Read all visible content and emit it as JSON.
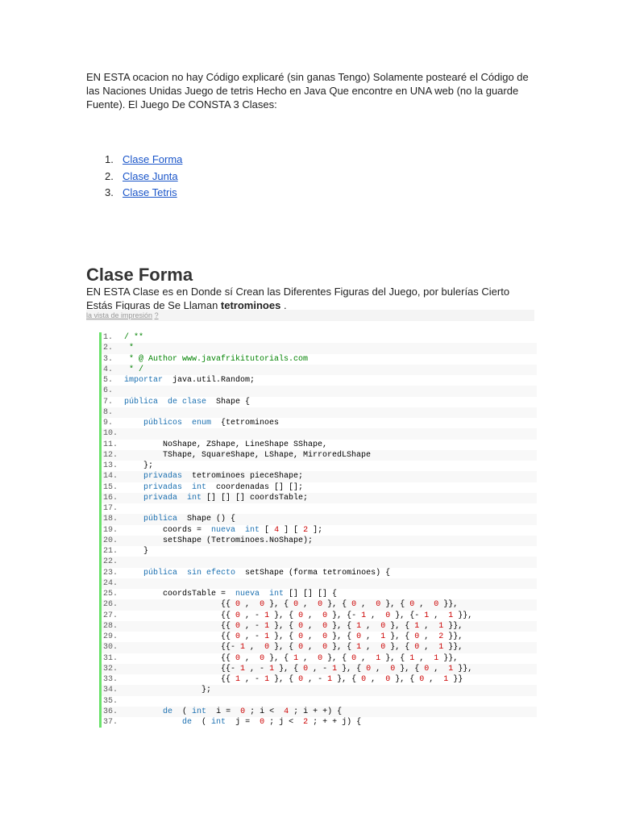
{
  "intro": "EN ESTA ocacion no hay Código explicaré (sin ganas Tengo) Solamente postearé el Código de las Naciones Unidas Juego de tetris Hecho en Java Que encontre en UNA web (no la guarde Fuente). El Juego De CONSTA 3 Clases:",
  "toc": [
    {
      "num": "1.",
      "label": "Clase Forma"
    },
    {
      "num": "2.",
      "label": "Clase Junta"
    },
    {
      "num": "3.",
      "label": "Clase Tetris"
    }
  ],
  "section": {
    "title": "Clase Forma",
    "para_before": "EN ESTA Clase es en Donde sí Crean las Diferentes Figuras del Juego, por bulerías Cierto Estás Figuras de Se Llaman ",
    "para_bold": "tetrominoes",
    "para_after": " .",
    "print_view": "la vista de impresión",
    "help": "?"
  },
  "code": [
    [
      [
        "c",
        "/ **"
      ]
    ],
    [
      [
        "c",
        " *"
      ]
    ],
    [
      [
        "c",
        " * @ Author www.javafrikitutorials.com"
      ]
    ],
    [
      [
        "c",
        " * /"
      ]
    ],
    [
      [
        "k",
        "importar"
      ],
      [
        "p",
        "  java.util.Random;"
      ]
    ],
    [],
    [
      [
        "k",
        "pública  de clase"
      ],
      [
        "p",
        "  Shape {"
      ]
    ],
    [],
    [
      [
        "p",
        "    "
      ],
      [
        "k",
        "públicos  enum"
      ],
      [
        "p",
        "  {tetrominoes"
      ]
    ],
    [],
    [
      [
        "p",
        "        NoShape, ZShape, LineShape SShape,"
      ]
    ],
    [
      [
        "p",
        "        TShape, SquareShape, LShape, MirroredLShape"
      ]
    ],
    [
      [
        "p",
        "    };"
      ]
    ],
    [
      [
        "p",
        "    "
      ],
      [
        "k",
        "privadas"
      ],
      [
        "p",
        "  tetrominoes pieceShape;"
      ]
    ],
    [
      [
        "p",
        "    "
      ],
      [
        "k",
        "privadas  int"
      ],
      [
        "p",
        "  coordenadas [] [];"
      ]
    ],
    [
      [
        "p",
        "    "
      ],
      [
        "k",
        "privada  int"
      ],
      [
        "p",
        " [] [] [] coordsTable;"
      ]
    ],
    [],
    [
      [
        "p",
        "    "
      ],
      [
        "k",
        "pública"
      ],
      [
        "p",
        "  Shape () {"
      ]
    ],
    [
      [
        "p",
        "        coords =  "
      ],
      [
        "k",
        "nueva  int"
      ],
      [
        "p",
        " [ "
      ],
      [
        "n",
        "4"
      ],
      [
        "p",
        " ] [ "
      ],
      [
        "n",
        "2"
      ],
      [
        "p",
        " ];"
      ]
    ],
    [
      [
        "p",
        "        setShape (Tetrominoes.NoShape);"
      ]
    ],
    [
      [
        "p",
        "    }"
      ]
    ],
    [],
    [
      [
        "p",
        "    "
      ],
      [
        "k",
        "pública  sin efecto"
      ],
      [
        "p",
        "  setShape (forma tetrominoes) {"
      ]
    ],
    [],
    [
      [
        "p",
        "        coordsTable =  "
      ],
      [
        "k",
        "nueva  int"
      ],
      [
        "p",
        " [] [] [] {"
      ]
    ],
    [
      [
        "p",
        "                    {{ "
      ],
      [
        "n",
        "0"
      ],
      [
        "p",
        " ,  "
      ],
      [
        "n",
        "0"
      ],
      [
        "p",
        " }, { "
      ],
      [
        "n",
        "0"
      ],
      [
        "p",
        " ,  "
      ],
      [
        "n",
        "0"
      ],
      [
        "p",
        " }, { "
      ],
      [
        "n",
        "0"
      ],
      [
        "p",
        " ,  "
      ],
      [
        "n",
        "0"
      ],
      [
        "p",
        " }, { "
      ],
      [
        "n",
        "0"
      ],
      [
        "p",
        " ,  "
      ],
      [
        "n",
        "0"
      ],
      [
        "p",
        " }},"
      ]
    ],
    [
      [
        "p",
        "                    {{ "
      ],
      [
        "n",
        "0"
      ],
      [
        "p",
        " , - "
      ],
      [
        "n",
        "1"
      ],
      [
        "p",
        " }, { "
      ],
      [
        "n",
        "0"
      ],
      [
        "p",
        " ,  "
      ],
      [
        "n",
        "0"
      ],
      [
        "p",
        " }, {- "
      ],
      [
        "n",
        "1"
      ],
      [
        "p",
        " ,  "
      ],
      [
        "n",
        "0"
      ],
      [
        "p",
        " }, {- "
      ],
      [
        "n",
        "1"
      ],
      [
        "p",
        " ,  "
      ],
      [
        "n",
        "1"
      ],
      [
        "p",
        " }},"
      ]
    ],
    [
      [
        "p",
        "                    {{ "
      ],
      [
        "n",
        "0"
      ],
      [
        "p",
        " , - "
      ],
      [
        "n",
        "1"
      ],
      [
        "p",
        " }, { "
      ],
      [
        "n",
        "0"
      ],
      [
        "p",
        " ,  "
      ],
      [
        "n",
        "0"
      ],
      [
        "p",
        " }, { "
      ],
      [
        "n",
        "1"
      ],
      [
        "p",
        " ,  "
      ],
      [
        "n",
        "0"
      ],
      [
        "p",
        " }, { "
      ],
      [
        "n",
        "1"
      ],
      [
        "p",
        " ,  "
      ],
      [
        "n",
        "1"
      ],
      [
        "p",
        " }},"
      ]
    ],
    [
      [
        "p",
        "                    {{ "
      ],
      [
        "n",
        "0"
      ],
      [
        "p",
        " , - "
      ],
      [
        "n",
        "1"
      ],
      [
        "p",
        " }, { "
      ],
      [
        "n",
        "0"
      ],
      [
        "p",
        " ,  "
      ],
      [
        "n",
        "0"
      ],
      [
        "p",
        " }, { "
      ],
      [
        "n",
        "0"
      ],
      [
        "p",
        " ,  "
      ],
      [
        "n",
        "1"
      ],
      [
        "p",
        " }, { "
      ],
      [
        "n",
        "0"
      ],
      [
        "p",
        " ,  "
      ],
      [
        "n",
        "2"
      ],
      [
        "p",
        " }},"
      ]
    ],
    [
      [
        "p",
        "                    {{- "
      ],
      [
        "n",
        "1"
      ],
      [
        "p",
        " ,  "
      ],
      [
        "n",
        "0"
      ],
      [
        "p",
        " }, { "
      ],
      [
        "n",
        "0"
      ],
      [
        "p",
        " ,  "
      ],
      [
        "n",
        "0"
      ],
      [
        "p",
        " }, { "
      ],
      [
        "n",
        "1"
      ],
      [
        "p",
        " ,  "
      ],
      [
        "n",
        "0"
      ],
      [
        "p",
        " }, { "
      ],
      [
        "n",
        "0"
      ],
      [
        "p",
        " ,  "
      ],
      [
        "n",
        "1"
      ],
      [
        "p",
        " }},"
      ]
    ],
    [
      [
        "p",
        "                    {{ "
      ],
      [
        "n",
        "0"
      ],
      [
        "p",
        " ,  "
      ],
      [
        "n",
        "0"
      ],
      [
        "p",
        " }, { "
      ],
      [
        "n",
        "1"
      ],
      [
        "p",
        " ,  "
      ],
      [
        "n",
        "0"
      ],
      [
        "p",
        " }, { "
      ],
      [
        "n",
        "0"
      ],
      [
        "p",
        " ,  "
      ],
      [
        "n",
        "1"
      ],
      [
        "p",
        " }, { "
      ],
      [
        "n",
        "1"
      ],
      [
        "p",
        " ,  "
      ],
      [
        "n",
        "1"
      ],
      [
        "p",
        " }},"
      ]
    ],
    [
      [
        "p",
        "                    {{- "
      ],
      [
        "n",
        "1"
      ],
      [
        "p",
        " , - "
      ],
      [
        "n",
        "1"
      ],
      [
        "p",
        " }, { "
      ],
      [
        "n",
        "0"
      ],
      [
        "p",
        " , - "
      ],
      [
        "n",
        "1"
      ],
      [
        "p",
        " }, { "
      ],
      [
        "n",
        "0"
      ],
      [
        "p",
        " ,  "
      ],
      [
        "n",
        "0"
      ],
      [
        "p",
        " }, { "
      ],
      [
        "n",
        "0"
      ],
      [
        "p",
        " ,  "
      ],
      [
        "n",
        "1"
      ],
      [
        "p",
        " }},"
      ]
    ],
    [
      [
        "p",
        "                    {{ "
      ],
      [
        "n",
        "1"
      ],
      [
        "p",
        " , - "
      ],
      [
        "n",
        "1"
      ],
      [
        "p",
        " }, { "
      ],
      [
        "n",
        "0"
      ],
      [
        "p",
        " , - "
      ],
      [
        "n",
        "1"
      ],
      [
        "p",
        " }, { "
      ],
      [
        "n",
        "0"
      ],
      [
        "p",
        " ,  "
      ],
      [
        "n",
        "0"
      ],
      [
        "p",
        " }, { "
      ],
      [
        "n",
        "0"
      ],
      [
        "p",
        " ,  "
      ],
      [
        "n",
        "1"
      ],
      [
        "p",
        " }}"
      ]
    ],
    [
      [
        "p",
        "                };"
      ]
    ],
    [],
    [
      [
        "p",
        "        "
      ],
      [
        "k",
        "de"
      ],
      [
        "p",
        "  ( "
      ],
      [
        "k",
        "int"
      ],
      [
        "p",
        "  i =  "
      ],
      [
        "n",
        "0"
      ],
      [
        "p",
        " ; i <  "
      ],
      [
        "n",
        "4"
      ],
      [
        "p",
        " ; i + +) {"
      ]
    ],
    [
      [
        "p",
        "            "
      ],
      [
        "k",
        "de"
      ],
      [
        "p",
        "  ( "
      ],
      [
        "k",
        "int"
      ],
      [
        "p",
        "  j =  "
      ],
      [
        "n",
        "0"
      ],
      [
        "p",
        " ; j <  "
      ],
      [
        "n",
        "2"
      ],
      [
        "p",
        " ; + + j) {"
      ]
    ]
  ]
}
